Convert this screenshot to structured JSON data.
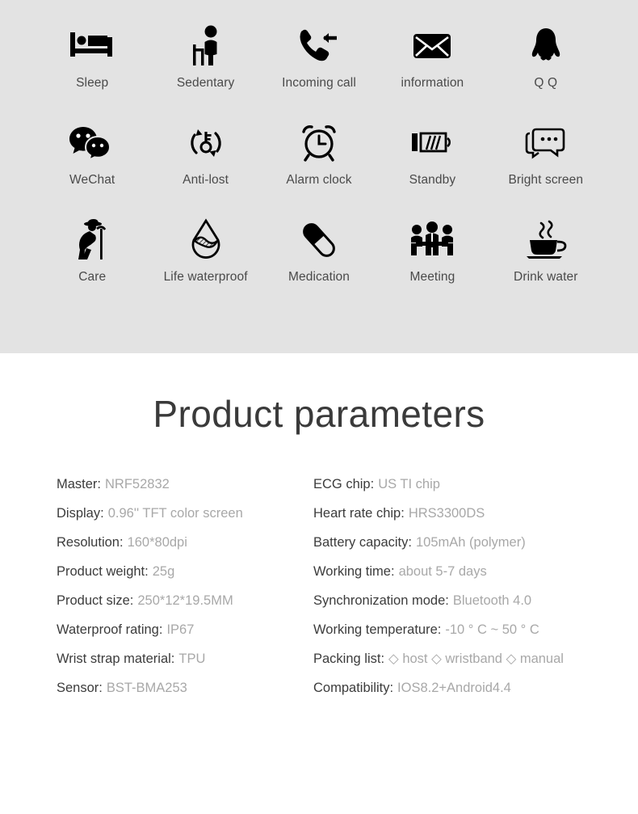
{
  "features": {
    "rows": [
      [
        {
          "label": "Sleep",
          "icon": "bed-icon"
        },
        {
          "label": "Sedentary",
          "icon": "sedentary-person-icon"
        },
        {
          "label": "Incoming call",
          "icon": "incoming-call-icon"
        },
        {
          "label": "information",
          "icon": "envelope-icon"
        },
        {
          "label": "Q Q",
          "icon": "qq-penguin-icon"
        }
      ],
      [
        {
          "label": "WeChat",
          "icon": "wechat-bubbles-icon"
        },
        {
          "label": "Anti-lost",
          "icon": "anti-lost-key-icon"
        },
        {
          "label": "Alarm clock",
          "icon": "alarm-clock-icon"
        },
        {
          "label": "Standby",
          "icon": "battery-icon"
        },
        {
          "label": "Bright screen",
          "icon": "chat-screen-icon"
        }
      ],
      [
        {
          "label": "Care",
          "icon": "elderly-care-icon"
        },
        {
          "label": "Life waterproof",
          "icon": "water-droplet-icon"
        },
        {
          "label": "Medication",
          "icon": "pill-capsule-icon"
        },
        {
          "label": "Meeting",
          "icon": "meeting-people-icon"
        },
        {
          "label": "Drink water",
          "icon": "coffee-cup-icon"
        }
      ]
    ]
  },
  "parameters": {
    "title": "Product parameters",
    "left": [
      {
        "label": "Master:",
        "value": "NRF52832"
      },
      {
        "label": "Display:",
        "value": "0.96'' TFT color screen"
      },
      {
        "label": "Resolution:",
        "value": "160*80dpi"
      },
      {
        "label": "Product weight:",
        "value": "25g"
      },
      {
        "label": "Product size:",
        "value": "250*12*19.5MM"
      },
      {
        "label": "Waterproof rating:",
        "value": "IP67"
      },
      {
        "label": "Wrist strap material:",
        "value": "TPU"
      },
      {
        "label": "Sensor:",
        "value": "BST-BMA253"
      }
    ],
    "right": [
      {
        "label": "ECG chip:",
        "value": "US TI chip"
      },
      {
        "label": "Heart rate chip:",
        "value": "HRS3300DS"
      },
      {
        "label": "Battery capacity:",
        "value": "105mAh (polymer)"
      },
      {
        "label": "Working time:",
        "value": "about 5-7 days"
      },
      {
        "label": "Synchronization mode:",
        "value": "Bluetooth 4.0"
      },
      {
        "label": "Working temperature:",
        "value": "-10 ° C ~ 50 ° C"
      },
      {
        "label": "Packing list:",
        "value": "◇ host ◇ wristband ◇ manual"
      },
      {
        "label": "Compatibility:",
        "value": "IOS8.2+Android4.4"
      }
    ]
  },
  "colors": {
    "panel_background": "#e3e3e3",
    "page_background": "#ffffff",
    "icon": "#000000",
    "label_text": "#4a4a4a",
    "param_label": "#3c3c3c",
    "param_value": "#a8a8a8",
    "title_text": "#3a3a3a"
  }
}
